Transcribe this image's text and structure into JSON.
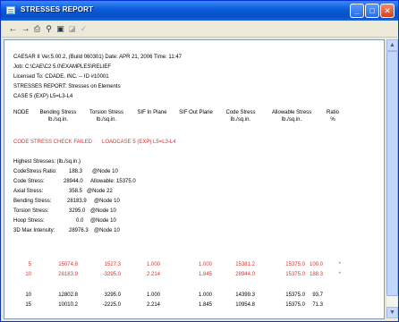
{
  "window": {
    "title": "STRESSES REPORT"
  },
  "toolbar": {
    "tools": [
      "back-icon",
      "forward-icon",
      "print-icon",
      "find-icon",
      "save-icon",
      "export-icon",
      "check-icon"
    ]
  },
  "header": {
    "line1": "CAESAR II Ver.5.00.2,  (Build 060301)  Date: APR 21, 2006   Time: 11:47",
    "line2": "Job: C:\\CAE\\C2 5.0\\EXAMPLES\\RELIEF",
    "line3": "Licensed To: CDADE, INC.  -- ID #10001",
    "line4": "STRESSES REPORT: Stresses on Elements",
    "line5": "CASE 5 (EXP) L5=L3-L4"
  },
  "columns": [
    {
      "l1": "NODE",
      "l2": "",
      "l3": ""
    },
    {
      "l1": "Bending Stress",
      "l2": "lb./sq.in.",
      "l3": ""
    },
    {
      "l1": "Torsion Stress",
      "l2": "lb./sq.in.",
      "l3": ""
    },
    {
      "l1": "SIF In Plane",
      "l2": "",
      "l3": ""
    },
    {
      "l1": "SIF Out Plane",
      "l2": "",
      "l3": ""
    },
    {
      "l1": "Code Stress",
      "l2": "lb./sq.in.",
      "l3": ""
    },
    {
      "l1": "Allowable Stress",
      "l2": "lb./sq.in.",
      "l3": ""
    },
    {
      "l1": "Ratio",
      "l2": "%",
      "l3": ""
    }
  ],
  "check": {
    "failed": "CODE STRESS CHECK FAILED",
    "loadcase": "LOADCASE 5 (EXP) L5=L3-L4"
  },
  "summary": {
    "title": "Highest Stresses: (lb./sq.in.)",
    "rows": [
      {
        "label": "CodeStress Ratio:",
        "value": "188.3",
        "extra": "@Node    10"
      },
      {
        "label": "Code Stress:",
        "value": "28944.0",
        "extra": "Allowable:   15375.0"
      },
      {
        "label": "Axial Stress:",
        "value": "358.5",
        "extra": "@Node    22"
      },
      {
        "label": "Bending Stress:",
        "value": "28183.9",
        "extra": "@Node    10"
      },
      {
        "label": "Torsion Stress:",
        "value": "3295.0",
        "extra": "@Node    10"
      },
      {
        "label": "Hoop Stress:",
        "value": "0.0",
        "extra": "@Node    10"
      },
      {
        "label": "3D Max Intensity:",
        "value": "28976.3",
        "extra": "@Node    10"
      }
    ]
  },
  "red_rows": [
    {
      "node": "5",
      "bending": "15074.8",
      "torsion": "1527.3",
      "sif_in": "1.000",
      "sif_out": "1.000",
      "code": "15381.2",
      "allow": "15375.0",
      "ratio": "100.0",
      "flag": "*"
    },
    {
      "node": "10",
      "bending": "28183.9",
      "torsion": "-3295.0",
      "sif_in": "2.214",
      "sif_out": "1.845",
      "code": "28944.0",
      "allow": "15375.0",
      "ratio": "188.3",
      "flag": "*"
    }
  ],
  "rows": [
    {
      "node": "10",
      "bending": "12802.8",
      "torsion": "3295.0",
      "sif_in": "1.000",
      "sif_out": "1.000",
      "code": "14399.3",
      "allow": "15375.0",
      "ratio": "93.7"
    },
    {
      "node": "15",
      "bending": "10010.2",
      "torsion": "-2225.0",
      "sif_in": "2.214",
      "sif_out": "1.845",
      "code": "10954.8",
      "allow": "15375.0",
      "ratio": "71.3"
    }
  ]
}
